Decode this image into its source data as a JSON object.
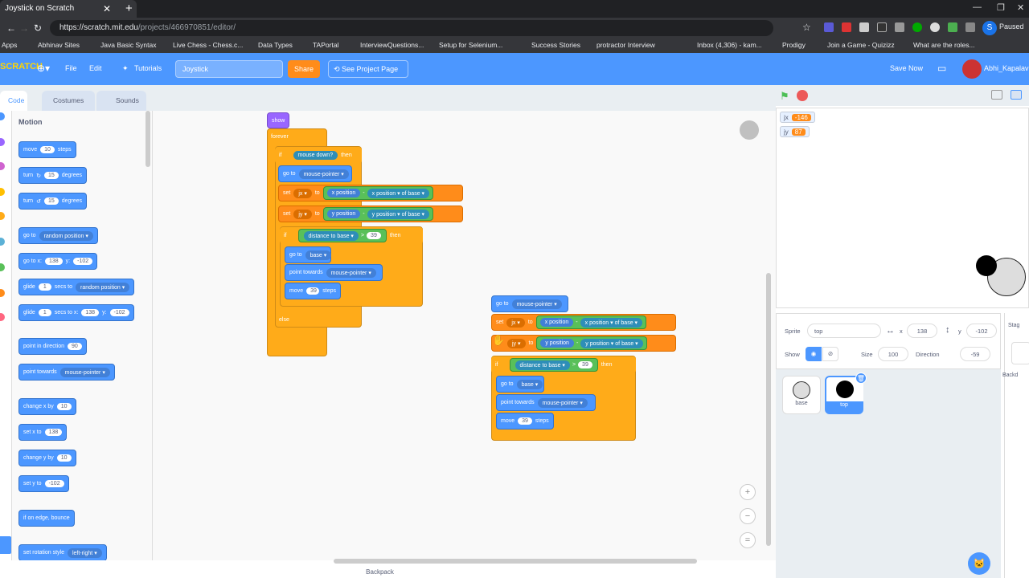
{
  "browser": {
    "tab_title": "Joystick on Scratch",
    "url_host": "https://scratch.mit.edu",
    "url_path": "/projects/466970851/editor/",
    "profile_initial": "S",
    "paused_label": "Paused"
  },
  "bookmarks": [
    "Apps",
    "Abhinav Sites",
    "Java Basic Syntax",
    "Live Chess - Chess.c...",
    "Data Types",
    "TAPortal",
    "InterviewQuestions...",
    "Setup for Selenium...",
    "Success Stories",
    "protractor Interview",
    "Inbox (4,306) - kam...",
    "Prodigy",
    "Join a Game - Quizizz",
    "What are the roles..."
  ],
  "menubar": {
    "logo": "SCRATCH",
    "file": "File",
    "edit": "Edit",
    "tutorials": "Tutorials",
    "project_title": "Joystick",
    "share": "Share",
    "see_project": "See Project Page",
    "save_now": "Save Now",
    "username": "Abhi_Kapalav"
  },
  "tabs": {
    "code": "Code",
    "costumes": "Costumes",
    "sounds": "Sounds"
  },
  "palette": {
    "heading": "Motion",
    "blocks": [
      {
        "parts": [
          "move",
          "10",
          "steps"
        ]
      },
      {
        "parts": [
          "turn",
          "↻",
          "15",
          "degrees"
        ]
      },
      {
        "parts": [
          "turn",
          "↺",
          "15",
          "degrees"
        ]
      },
      {
        "parts": [
          "go to",
          "random position ▾"
        ]
      },
      {
        "parts": [
          "go to x:",
          "138",
          "y:",
          "-102"
        ]
      },
      {
        "parts": [
          "glide",
          "1",
          "secs to",
          "random position ▾"
        ]
      },
      {
        "parts": [
          "glide",
          "1",
          "secs to x:",
          "138",
          "y:",
          "-102"
        ]
      },
      {
        "parts": [
          "point in direction",
          "90"
        ]
      },
      {
        "parts": [
          "point towards",
          "mouse-pointer ▾"
        ]
      },
      {
        "parts": [
          "change x by",
          "10"
        ]
      },
      {
        "parts": [
          "set x to",
          "138"
        ]
      },
      {
        "parts": [
          "change y by",
          "10"
        ]
      },
      {
        "parts": [
          "set y to",
          "-102"
        ]
      },
      {
        "parts": [
          "if on edge, bounce"
        ]
      },
      {
        "parts": [
          "set rotation style",
          "left-right ▾"
        ]
      }
    ]
  },
  "script1": {
    "show": "show",
    "forever": "forever",
    "if": "if",
    "mouse_down": "mouse down?",
    "then": "then",
    "goto": "go to",
    "mouse_pointer": "mouse-pointer ▾",
    "set": "set",
    "jx": "jx ▾",
    "jy": "jy ▾",
    "to": "to",
    "x_position": "x position",
    "y_position": "y position",
    "minus": "-",
    "x_pos_dd": "x position ▾",
    "y_pos_dd": "y position ▾",
    "of": "of",
    "base_dd": "base ▾",
    "distance_to": "distance to",
    "gt": ">",
    "dist_val": "39",
    "point_towards": "point towards",
    "move": "move",
    "steps": "steps",
    "else": "else"
  },
  "stage": {
    "monitors": [
      {
        "name": "jx",
        "value": "-146"
      },
      {
        "name": "jy",
        "value": "87"
      }
    ]
  },
  "sprite_info": {
    "sprite_label": "Sprite",
    "sprite_name": "top",
    "x_label": "x",
    "x_val": "138",
    "y_label": "y",
    "y_val": "-102",
    "show_label": "Show",
    "size_label": "Size",
    "size_val": "100",
    "direction_label": "Direction",
    "direction_val": "-59"
  },
  "sprites": [
    {
      "name": "base"
    },
    {
      "name": "top"
    }
  ],
  "stage_col": {
    "label": "Stag",
    "backdrops": "Backd"
  },
  "backpack": "Backpack",
  "zoom": {
    "in": "+",
    "out": "−",
    "reset": "="
  }
}
